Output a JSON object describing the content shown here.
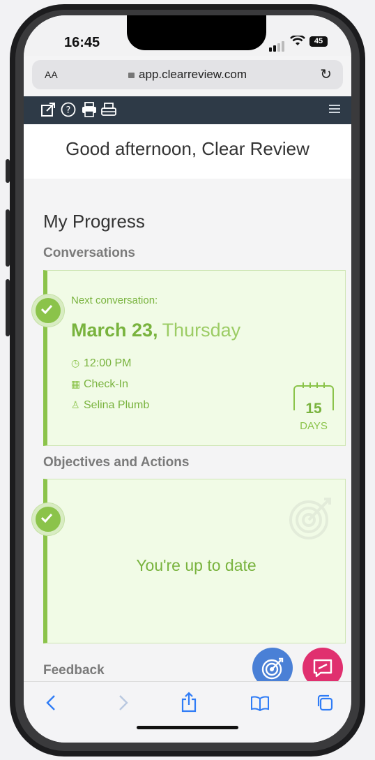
{
  "status": {
    "time": "16:45",
    "battery": "45"
  },
  "browser": {
    "text_size_label": "AA",
    "url": "app.clearreview.com"
  },
  "greeting": "Good afternoon, Clear Review",
  "progress": {
    "title": "My Progress",
    "conversations": {
      "heading": "Conversations",
      "next_label": "Next conversation:",
      "date_bold": "March 23,",
      "weekday": "Thursday",
      "time": "12:00 PM",
      "type": "Check-In",
      "person": "Selina Plumb",
      "days_count": "15",
      "days_label": "DAYS"
    },
    "objectives": {
      "heading": "Objectives and Actions",
      "status_text": "You're up to date"
    },
    "feedback": {
      "heading": "Feedback"
    }
  },
  "colors": {
    "accent_green": "#8bc34a",
    "toolbar": "#2e3a47",
    "fab_blue": "#4a80d6",
    "fab_pink": "#e0306f",
    "ios_blue": "#2f7cf6"
  },
  "icons": {
    "toolbar": [
      "external-link-icon",
      "help-icon",
      "print-icon",
      "printer-icon"
    ],
    "safari_bar": [
      "back-icon",
      "forward-icon",
      "share-icon",
      "bookmarks-icon",
      "tabs-icon"
    ]
  }
}
